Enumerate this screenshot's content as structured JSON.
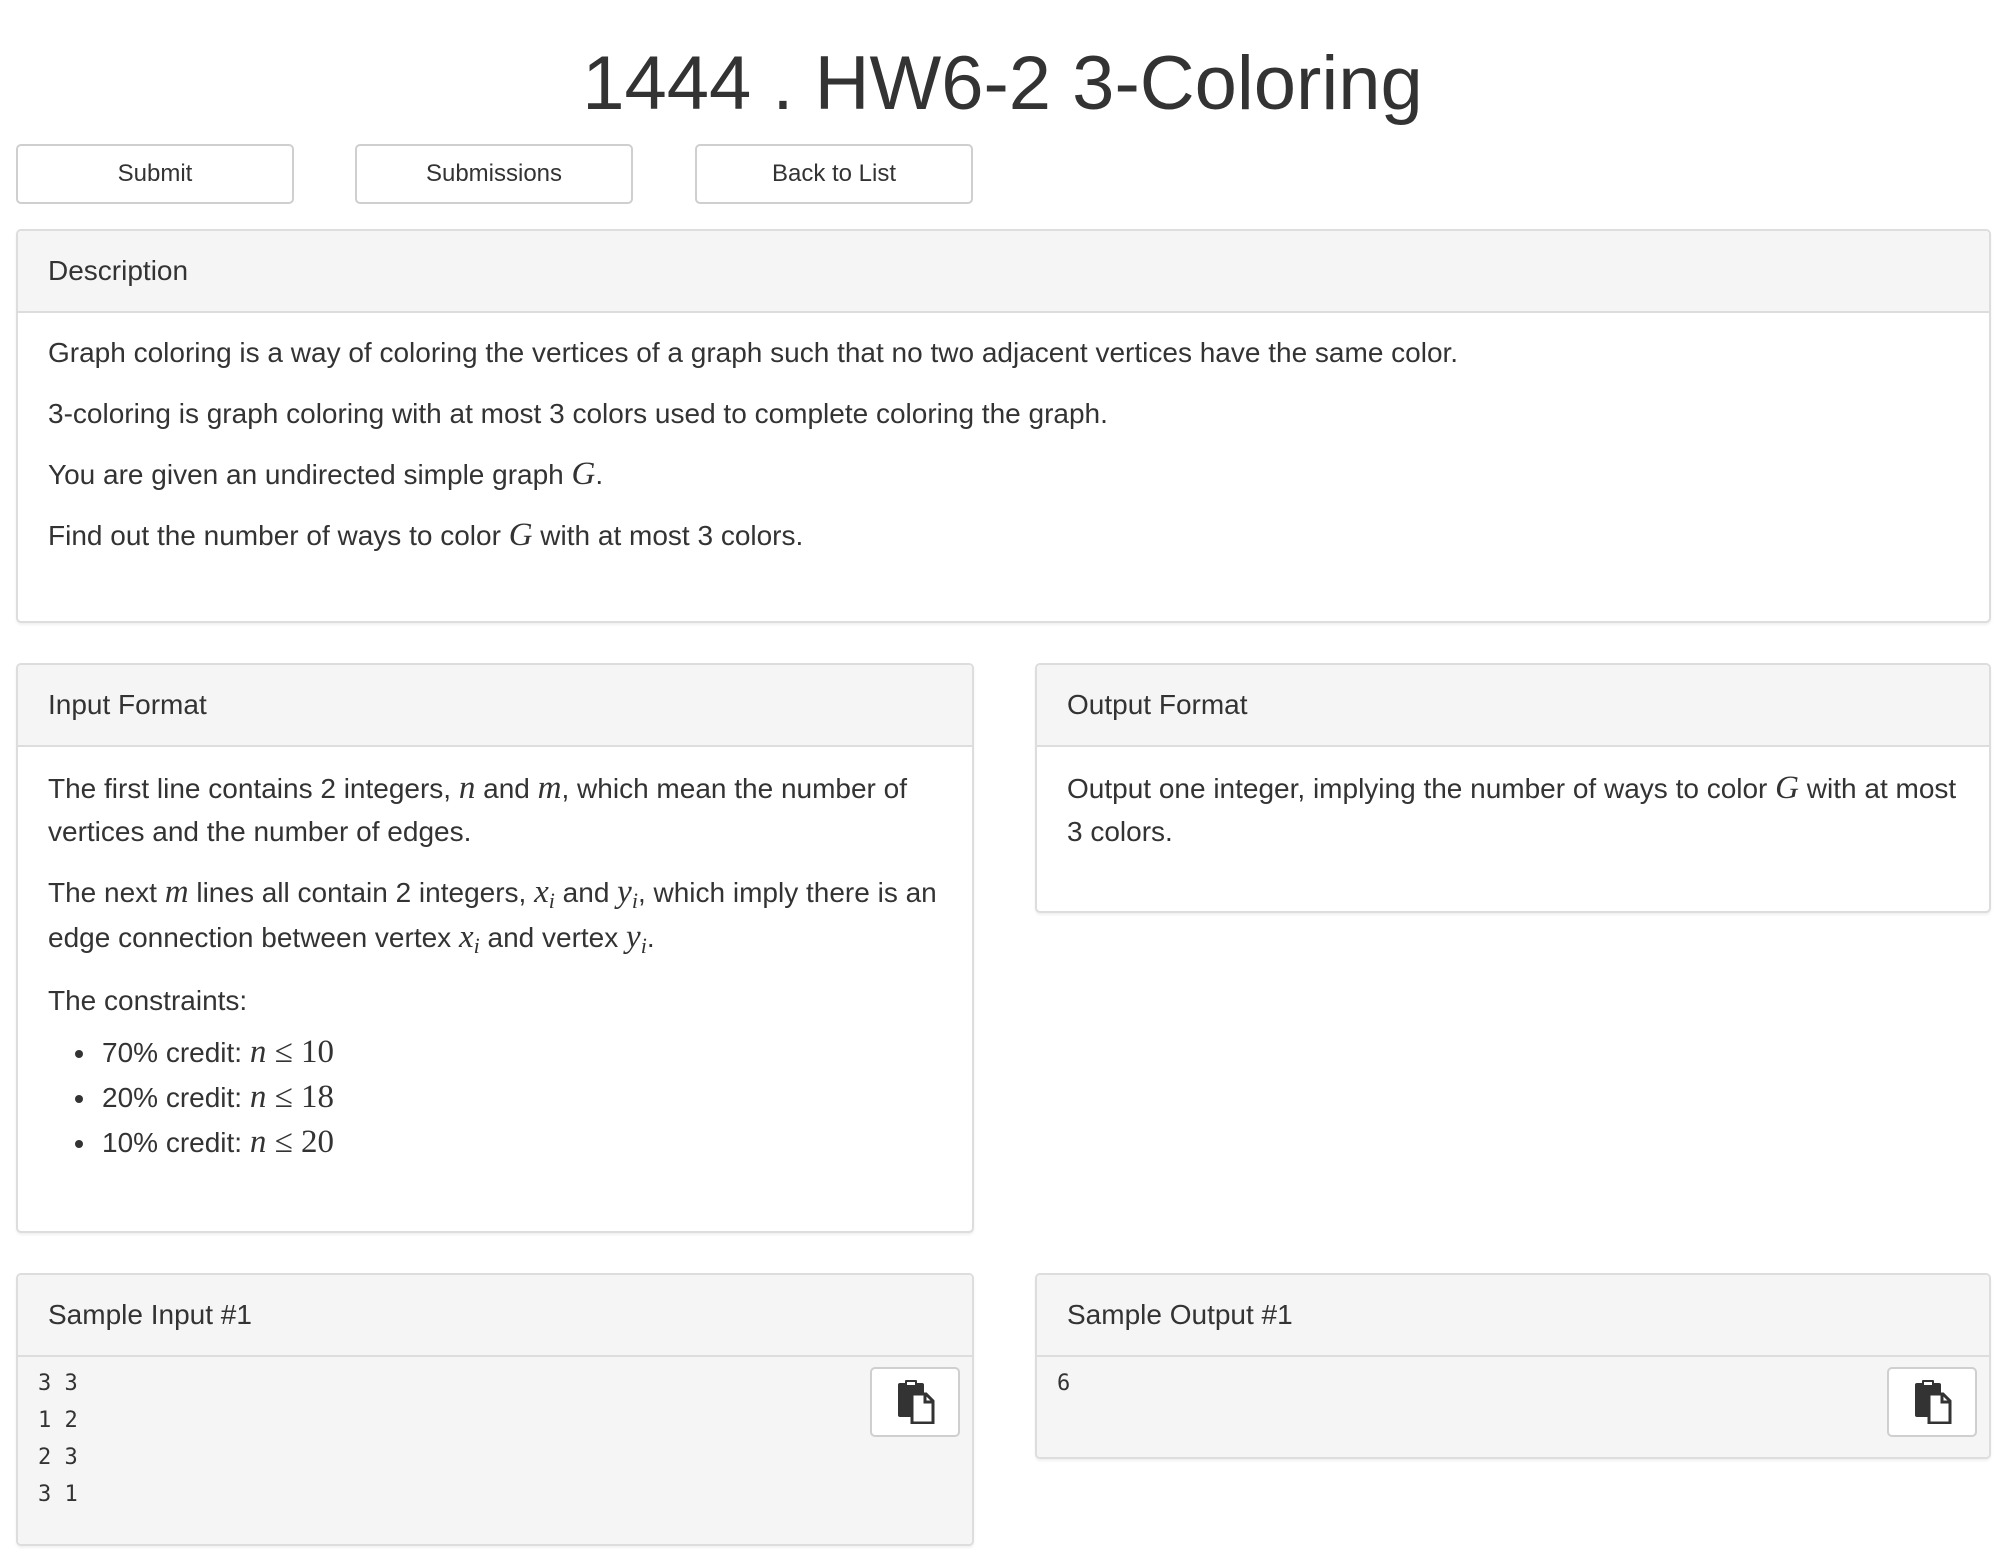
{
  "header": {
    "title": "1444 . HW6-2 3-Coloring"
  },
  "toolbar": {
    "submit_label": "Submit",
    "submissions_label": "Submissions",
    "back_label": "Back to List"
  },
  "description": {
    "heading": "Description",
    "p1": "Graph coloring is a way of coloring the vertices of a graph such that no two adjacent vertices have the same color.",
    "p2": "3-coloring is graph coloring with at most 3 colors used to complete coloring the graph.",
    "p3_pre": "You are given an undirected simple graph ",
    "p3_var": "G",
    "p3_post": ".",
    "p4_pre": "Find out the number of ways to color ",
    "p4_var": "G",
    "p4_post": " with at most 3 colors."
  },
  "input_format": {
    "heading": "Input Format",
    "p1_a": "The first line contains 2 integers, ",
    "p1_n": "n",
    "p1_b": " and ",
    "p1_m": "m",
    "p1_c": ", which mean the number of vertices and the number of edges.",
    "p2_a": "The next ",
    "p2_m": "m",
    "p2_b": " lines all contain 2 integers, ",
    "p2_x": "x",
    "p2_xi": "i",
    "p2_c": " and ",
    "p2_y": "y",
    "p2_yi": "i",
    "p2_d": ", which imply there is an edge connection between vertex ",
    "p2_x2": "x",
    "p2_x2i": "i",
    "p2_e": " and vertex ",
    "p2_y2": "y",
    "p2_y2i": "i",
    "p2_f": ".",
    "constraints_label": "The constraints:",
    "credits": [
      {
        "label": "70% credit: ",
        "var": "n",
        "op": " ≤ ",
        "num": "10"
      },
      {
        "label": "20% credit: ",
        "var": "n",
        "op": " ≤ ",
        "num": "18"
      },
      {
        "label": "10% credit: ",
        "var": "n",
        "op": " ≤ ",
        "num": "20"
      }
    ]
  },
  "output_format": {
    "heading": "Output Format",
    "p1_pre": "Output one integer, implying the number of ways to color ",
    "p1_var": "G",
    "p1_post": " with at most 3 colors."
  },
  "sample_input": {
    "heading": "Sample Input #1",
    "content": "3 3\n1 2\n2 3\n3 1"
  },
  "sample_output": {
    "heading": "Sample Output #1",
    "content": "6"
  },
  "icons": {
    "copy": "clipboard-copy-icon"
  },
  "colors": {
    "text": "#333333",
    "panel_header_bg": "#f5f5f5",
    "border": "#dddddd"
  }
}
